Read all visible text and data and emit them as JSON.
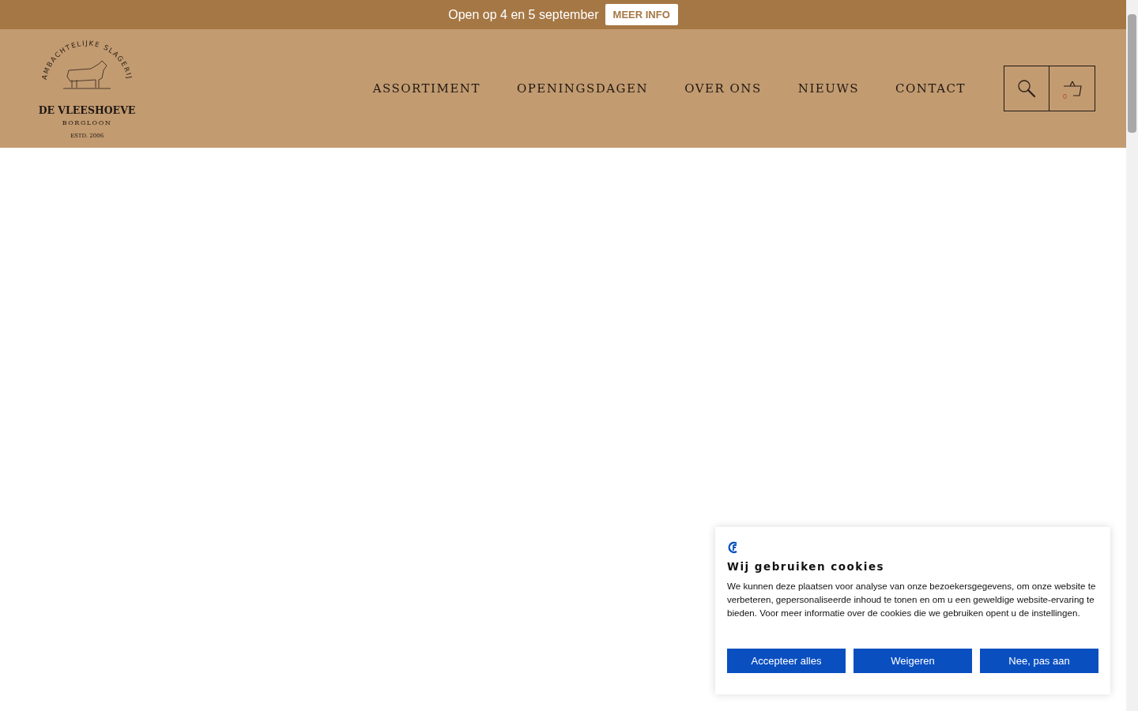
{
  "announcement": {
    "text": "Open op 4 en 5 september",
    "button": "MEER INFO"
  },
  "logo": {
    "arc": "AMBACHTELIJKE SLAGERIJ",
    "name": "DE VLEESHOEVE",
    "place": "BORGLOON",
    "established": "ESTD. 2006"
  },
  "nav": [
    "ASSORTIMENT",
    "OPENINGSDAGEN",
    "OVER ONS",
    "NIEUWS",
    "CONTACT"
  ],
  "cart": {
    "count": "0"
  },
  "cookie_banner": {
    "title": "Wij gebruiken cookies",
    "text": "We kunnen deze plaatsen voor analyse van onze bezoekersgegevens, om onze website te verbeteren, gepersonaliseerde inhoud te tonen en om u een geweldige website-ervaring te bieden. Voor meer informatie over de cookies die we gebruiken opent u de instellingen.",
    "buttons": [
      "Accepteer alles",
      "Weigeren",
      "Nee, pas aan"
    ]
  }
}
